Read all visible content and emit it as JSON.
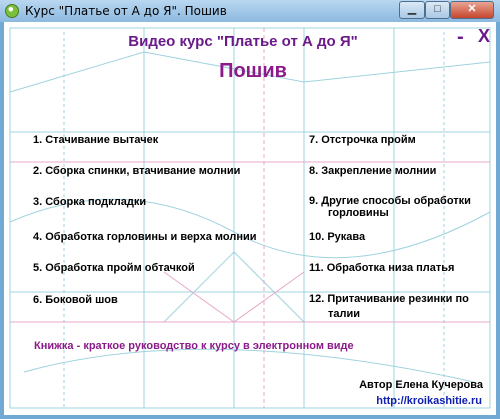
{
  "window": {
    "title": "Курс \"Платье от А до Я\". Пошив",
    "minimize_glyph": "▁",
    "maximize_glyph": "□",
    "close_glyph": "✕"
  },
  "app": {
    "minimize_label": "-",
    "close_label": "X",
    "header_small": "Видео курс \"Платье от А до Я\"",
    "header_big": "Пошив"
  },
  "lessons_left": [
    "1. Стачивание вытачек",
    "2. Сборка спинки, втачивание молнии",
    "3. Сборка подкладки",
    "4. Обработка горловины и верха молнии",
    "5. Обработка пройм обтачкой",
    "6. Боковой шов"
  ],
  "lessons_right": [
    "7. Отстрочка пройм",
    "8. Закрепление молнии",
    "9. Другие способы обработки",
    "горловины",
    "10. Рукава",
    "11. Обработка низа платья",
    "12. Притачивание резинки по",
    "талии"
  ],
  "book_link": "Книжка - краткое руководство к курсу в электронном виде",
  "author": "Автор Елена Кучерова",
  "site": "http://kroikashitie.ru",
  "colors": {
    "header": "#6b1a8a",
    "accent": "#8b1a8a",
    "link": "#1020b0",
    "pattern_lines": "#9fd3de",
    "pattern_pink": "#e7a8c8"
  }
}
